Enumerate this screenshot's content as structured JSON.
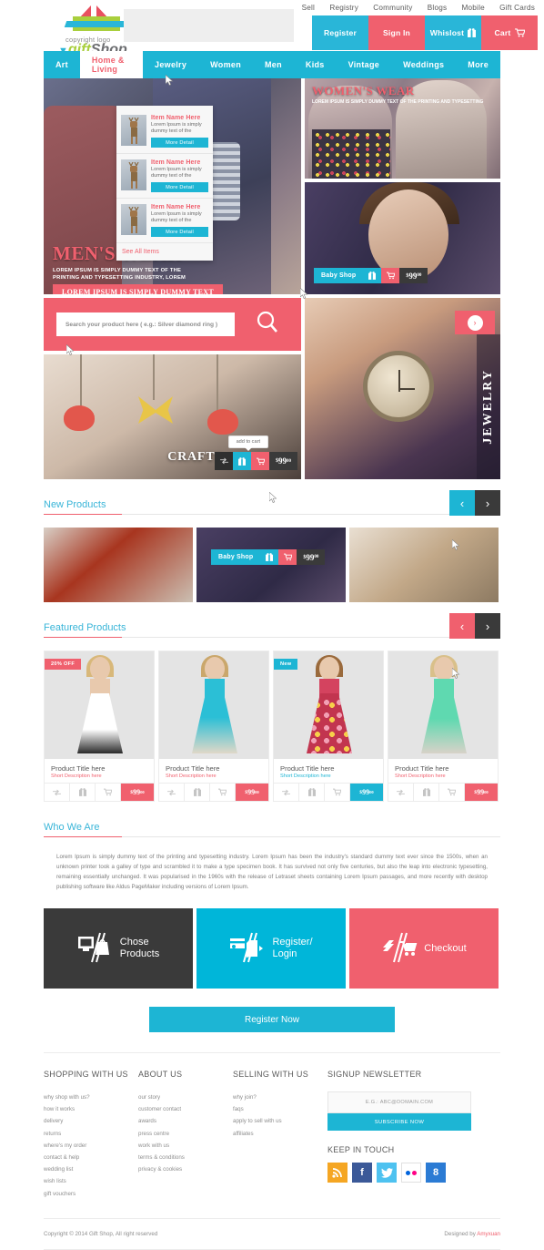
{
  "brand": {
    "logo_copy": "copyright logo",
    "logo_name_gift": "gift",
    "logo_name_shop": "Shop"
  },
  "topbar": {
    "links": [
      "Sell",
      "Registry",
      "Community",
      "Blogs",
      "Mobile",
      "Gift Cards"
    ],
    "buttons": [
      {
        "label": "Register",
        "color": "#29b6d8",
        "icon": ""
      },
      {
        "label": "Sign In",
        "color": "#f0606e",
        "icon": ""
      },
      {
        "label": "Whislost",
        "color": "#29b6d8",
        "icon": "gift-icon"
      },
      {
        "label": "Cart",
        "color": "#f0606e",
        "icon": "cart-icon"
      }
    ]
  },
  "nav": {
    "items": [
      "Art",
      "Home & Living",
      "Jewelry",
      "Women",
      "Men",
      "Kids",
      "Vintage",
      "Weddings",
      "More"
    ],
    "active": "Home & Living"
  },
  "dropdown": {
    "items": [
      {
        "title": "Item Name Here",
        "desc": "Lorem Ipsum is simply dummy text of the",
        "button": "More Detail"
      },
      {
        "title": "Item Name Here",
        "desc": "Lorem Ipsum is simply dummy text of the",
        "button": "More Detail"
      },
      {
        "title": "Item Name Here",
        "desc": "Lorem Ipsum is simply dummy text of the",
        "button": "More Detail"
      }
    ],
    "see_all": "See All Items"
  },
  "hero": {
    "mens": {
      "title": "MEN'S WEAR",
      "subtitle": "LOREM IPSUM IS SIMPLY DUMMY TEXT OF THE PRINTING AND TYPESETTING INDUSTRY, LOREM",
      "ribbon": "LOREM IPSUM IS SIMPLY DUMMY TEXT"
    },
    "womens": {
      "title": "WOMEN'S WEAR",
      "subtitle": "LOREM IPSUM IS SIMPLY DUMMY TEXT OF THE PRINTING AND TYPESETTING"
    },
    "baby": {
      "label": "Baby Shop",
      "price_dollar": "$",
      "price_main": "99",
      "price_cents": "00"
    },
    "search": {
      "placeholder": "Search your product here ( e.g.: Silver diamond ring )",
      "value": ""
    },
    "crafts": {
      "title": "CRAFTS",
      "tooltip": "add to cart",
      "price_dollar": "$",
      "price_main": "99",
      "price_cents": "00"
    },
    "jewelry": {
      "title": "JEWELRY",
      "arrow": "›"
    }
  },
  "new_products": {
    "title": "New Products",
    "prev": "‹",
    "next": "›",
    "cards": [
      {
        "badge_label": "",
        "has_bar": false
      },
      {
        "badge_label": "Baby Shop",
        "has_bar": true,
        "price_dollar": "$",
        "price_main": "99",
        "price_cents": "00"
      },
      {
        "badge_label": "",
        "has_bar": false
      }
    ]
  },
  "featured": {
    "title": "Featured Products",
    "prev": "‹",
    "next": "›",
    "products": [
      {
        "badge": "20% OFF",
        "badge_color": "#f0606e",
        "title": "Product Title here",
        "desc": "Short Description here",
        "accent": "#f0606e",
        "price_dollar": "$",
        "price_main": "99",
        "price_cents": "00"
      },
      {
        "badge": "",
        "badge_color": "",
        "title": "Product Title here",
        "desc": "Short Description here",
        "accent": "#f0606e",
        "price_dollar": "$",
        "price_main": "99",
        "price_cents": "00"
      },
      {
        "badge": "New",
        "badge_color": "#1db5d4",
        "title": "Product Title here",
        "desc": "Short Description here",
        "accent": "#1db5d4",
        "price_dollar": "$",
        "price_main": "99",
        "price_cents": "00"
      },
      {
        "badge": "",
        "badge_color": "",
        "title": "Product Title here",
        "desc": "Short Description here",
        "accent": "#f0606e",
        "price_dollar": "$",
        "price_main": "99",
        "price_cents": "00"
      }
    ]
  },
  "about": {
    "title": "Who We Are",
    "body": "Lorem Ipsum is simply dummy text of the printing and typesetting industry. Lorem Ipsum has been the industry's standard dummy text ever since the 1500s, when an unknown printer took a galley of type and scrambled it to make a type specimen book. It has survived not only five centuries, but also the leap into electronic typesetting, remaining essentially unchanged. It was popularised in the 1960s with the release of Letraset sheets containing Lorem Ipsum passages, and more recently with desktop publishing software like Aldus PageMaker including versions of Lorem Ipsum."
  },
  "process": {
    "boxes": [
      {
        "label": "Chose\nProducts",
        "color": "#3a3a3a",
        "icon": "monitor-bag-icon"
      },
      {
        "label": "Register/\nLogin",
        "color": "#00b6d9",
        "icon": "card-login-icon"
      },
      {
        "label": "Checkout",
        "color": "#f0606e",
        "icon": "cart-checkout-icon"
      }
    ],
    "register_now": "Register Now"
  },
  "footer": {
    "columns": [
      {
        "heading": "SHOPPING WITH US",
        "links": [
          "why shop with us?",
          "how it works",
          "delivery",
          "returns",
          "where's my order",
          "contact & help",
          "wedding list",
          "wish lists",
          "gift vouchers"
        ]
      },
      {
        "heading": "ABOUT US",
        "links": [
          "our story",
          "customer contact",
          "awards",
          "press centre",
          "work with us",
          "terms & conditions",
          "privacy & cookies"
        ]
      },
      {
        "heading": "SELLING WITH US",
        "links": [
          "why join?",
          "faqs",
          "apply to sell with us",
          "affiliates"
        ]
      }
    ],
    "newsletter": {
      "heading": "SIGNUP NEWSLETTER",
      "placeholder": "E.G.: ABC@DOMAIN.COM",
      "button": "SUBSCRIBE NOW"
    },
    "keep_in_touch": {
      "heading": "KEEP IN TOUCH",
      "socials": [
        "rss-icon",
        "facebook-icon",
        "twitter-icon",
        "flickr-icon",
        "google-plus-icon"
      ]
    },
    "copyright": "Copyright © 2014 Gift Shop, All right reserved",
    "designed_by_prefix": "Designed by ",
    "designed_by": "Amyxuan"
  }
}
